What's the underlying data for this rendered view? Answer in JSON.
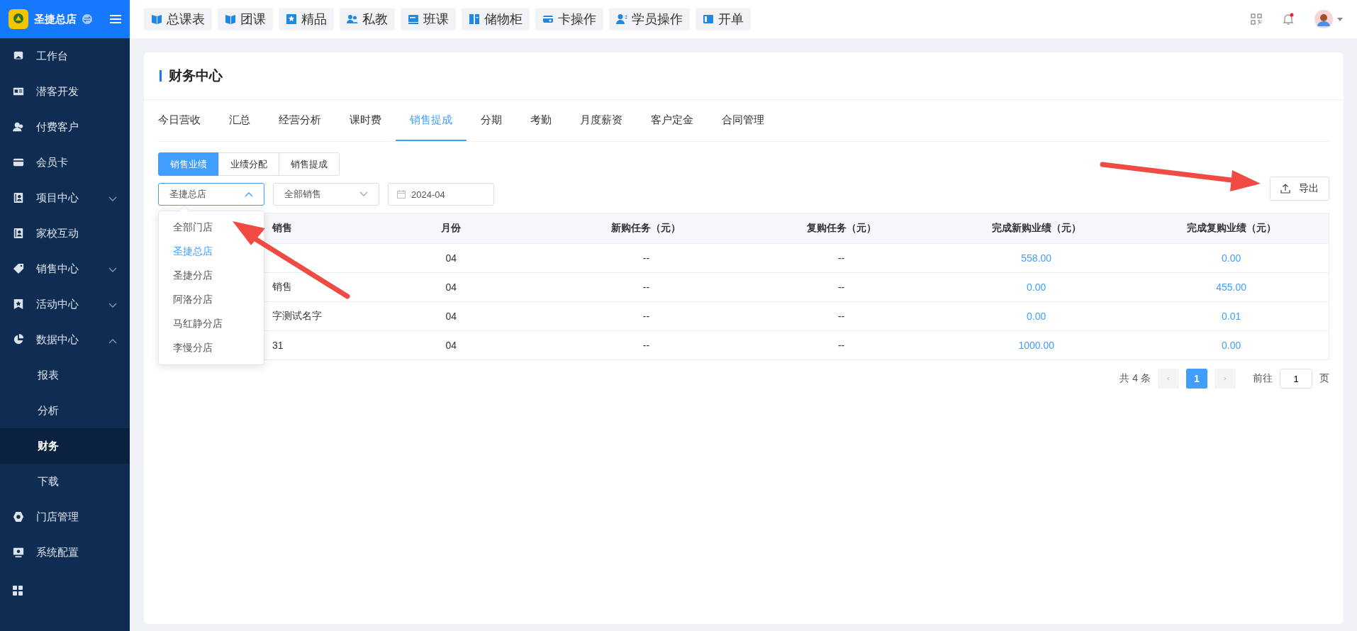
{
  "sidebar": {
    "store_name": "圣捷总店",
    "items": [
      {
        "label": "工作台",
        "selected": false
      },
      {
        "label": "潜客开发",
        "selected": false
      },
      {
        "label": "付费客户",
        "selected": false
      },
      {
        "label": "会员卡",
        "selected": false
      },
      {
        "label": "项目中心",
        "selected": false,
        "expanded": false
      },
      {
        "label": "家校互动",
        "selected": false
      },
      {
        "label": "销售中心",
        "selected": false,
        "expanded": false
      },
      {
        "label": "活动中心",
        "selected": false,
        "expanded": false
      },
      {
        "label": "数据中心",
        "selected": false,
        "expanded": true,
        "children": [
          {
            "label": "报表",
            "selected": false
          },
          {
            "label": "分析",
            "selected": false
          },
          {
            "label": "财务",
            "selected": true
          },
          {
            "label": "下载",
            "selected": false
          }
        ]
      },
      {
        "label": "门店管理",
        "selected": false
      },
      {
        "label": "系统配置",
        "selected": false
      }
    ]
  },
  "quick_actions": [
    "总课表",
    "团课",
    "精品",
    "私教",
    "班课",
    "储物柜",
    "卡操作",
    "学员操作",
    "开单"
  ],
  "header": {
    "has_unread": true
  },
  "page": {
    "title": "财务中心",
    "tabs": [
      {
        "label": "今日营收",
        "selected": false
      },
      {
        "label": "汇总",
        "selected": false
      },
      {
        "label": "经营分析",
        "selected": false
      },
      {
        "label": "课时费",
        "selected": false
      },
      {
        "label": "销售提成",
        "selected": true
      },
      {
        "label": "分期",
        "selected": false
      },
      {
        "label": "考勤",
        "selected": false
      },
      {
        "label": "月度薪资",
        "selected": false
      },
      {
        "label": "客户定金",
        "selected": false
      },
      {
        "label": "合同管理",
        "selected": false
      }
    ],
    "sub_tabs": [
      {
        "label": "销售业绩",
        "selected": true
      },
      {
        "label": "业绩分配",
        "selected": false
      },
      {
        "label": "销售提成",
        "selected": false
      }
    ],
    "filters": {
      "store": {
        "value": "圣捷总店",
        "open": true
      },
      "sales": {
        "value": "全部销售",
        "open": false
      },
      "month": {
        "value": "2024-04"
      }
    },
    "store_options": [
      {
        "label": "全部门店",
        "selected": false
      },
      {
        "label": "圣捷总店",
        "selected": true
      },
      {
        "label": "圣捷分店",
        "selected": false
      },
      {
        "label": "阿洛分店",
        "selected": false
      },
      {
        "label": "马红静分店",
        "selected": false
      },
      {
        "label": "李慢分店",
        "selected": false
      }
    ],
    "export_button": "导出",
    "table": {
      "columns": [
        "销售",
        "月份",
        "新购任务（元）",
        "复购任务（元）",
        "完成新购业绩（元）",
        "完成复购业绩（元）"
      ],
      "rows": [
        [
          "",
          "04",
          "--",
          "--",
          "558.00",
          "0.00"
        ],
        [
          "销售",
          "04",
          "--",
          "--",
          "0.00",
          "455.00"
        ],
        [
          "字测试名字",
          "04",
          "--",
          "--",
          "0.00",
          "0.01"
        ],
        [
          "31",
          "04",
          "--",
          "--",
          "1000.00",
          "0.00"
        ]
      ]
    },
    "pagination": {
      "total": "共 4 条",
      "pages": [
        {
          "label": "1",
          "selected": true
        }
      ],
      "goto_label": "前往",
      "goto_value": "1",
      "page_suffix": "页"
    }
  }
}
